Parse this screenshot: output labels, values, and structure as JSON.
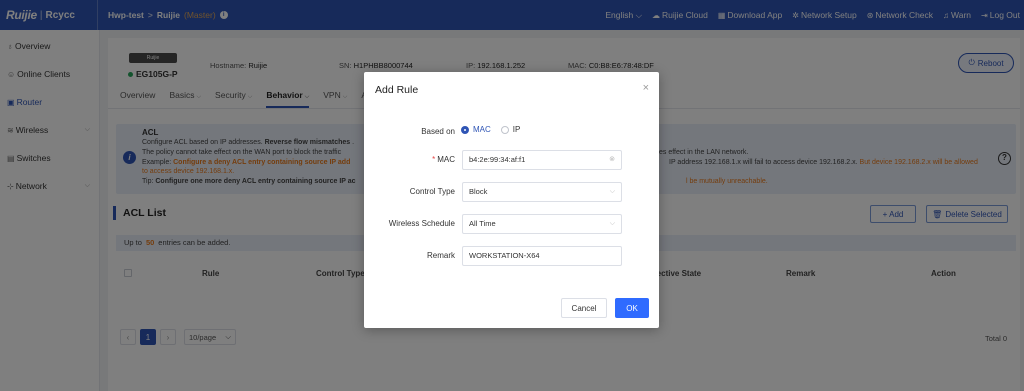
{
  "topbar": {
    "logo_main": "Ruijie",
    "logo_sep": "|",
    "logo_sub": "Rcycc",
    "project": "Hwp-test",
    "crumb_sep": ">",
    "device_name": "Ruijie",
    "device_role": "(Master)",
    "info_icon": "i",
    "right": [
      {
        "icon": "",
        "label": "English ⌵",
        "name": "language-select"
      },
      {
        "icon": "☁",
        "label": "Ruijie Cloud",
        "name": "ruijie-cloud-link"
      },
      {
        "icon": "▦",
        "label": "Download App",
        "name": "download-app-link"
      },
      {
        "icon": "✲",
        "label": "Network Setup",
        "name": "network-setup-link"
      },
      {
        "icon": "⊛",
        "label": "Network Check",
        "name": "network-check-link"
      },
      {
        "icon": "♫",
        "label": "Warn",
        "name": "warn-link"
      },
      {
        "icon": "⇥",
        "label": "Log Out",
        "name": "logout-link"
      }
    ]
  },
  "sidebar": {
    "items": [
      {
        "icon": "♁",
        "label": "Overview",
        "chevron": "",
        "active": false
      },
      {
        "icon": "☺",
        "label": "Online Clients",
        "chevron": "",
        "active": false
      },
      {
        "icon": "▣",
        "label": "Router",
        "chevron": "",
        "active": true
      },
      {
        "icon": "≋",
        "label": "Wireless",
        "chevron": "⌵",
        "active": false
      },
      {
        "icon": "▤",
        "label": "Switches",
        "chevron": "",
        "active": false
      },
      {
        "icon": "⊹",
        "label": "Network",
        "chevron": "⌵",
        "active": false
      }
    ]
  },
  "device": {
    "badge": "Ruijie",
    "model": "EG105G-P",
    "hostname_label": "Hostname:",
    "hostname": "Ruijie",
    "sn_label": "SN:",
    "sn": "H1PHBB8000744",
    "ip_label": "IP:",
    "ip": "192.168.1.252",
    "mac_label": "MAC:",
    "mac": "C0:B8:E6:78:48:DF",
    "reboot_icon": "⏻",
    "reboot_label": "Reboot"
  },
  "tabs": [
    {
      "label": "Overview",
      "caret": "",
      "active": false
    },
    {
      "label": "Basics",
      "caret": "⌵",
      "active": false
    },
    {
      "label": "Security",
      "caret": "⌵",
      "active": false
    },
    {
      "label": "Behavior",
      "caret": "⌵",
      "active": true
    },
    {
      "label": "VPN",
      "caret": "⌵",
      "active": false
    },
    {
      "label": "Adv",
      "caret": "",
      "active": false
    }
  ],
  "notice": {
    "icon": "i",
    "title": "ACL",
    "line1_a": "Configure ACL based on IP addresses. ",
    "line1_b": "Reverse flow mismatches",
    "line1_c": " .",
    "line2": "The policy cannot take effect on the WAN port to block the traffic",
    "line3_a": "Example: ",
    "line3_b": "Configure a deny ACL entry containing source IP add",
    "line4": "to access device 192.168.1.x.",
    "line5_a": "Tip: ",
    "line5_b": "Configure one more deny ACL entry containing source IP ac",
    "right2": "es effect in the LAN network.",
    "right3_a": "IP address 192.168.1.x will fail to access device 192.168.2.x. ",
    "right3_b": "But device 192.168.2.x will be allowed",
    "right5": "l be mutually unreachable.",
    "help_icon": "?"
  },
  "acl": {
    "title": "ACL List",
    "add_label": "+ Add",
    "delete_icon": "🗑",
    "delete_label": "Delete Selected",
    "limit_prefix": "Up to",
    "limit_num": "50",
    "limit_suffix": "entries can be added.",
    "columns": [
      "Rule",
      "Control Type",
      "Effective State",
      "Remark",
      "Action"
    ]
  },
  "pager": {
    "prev": "‹",
    "page": "1",
    "next": "›",
    "size": "10/page",
    "size_caret": "⌵",
    "total": "Total 0"
  },
  "modal": {
    "title": "Add Rule",
    "close": "×",
    "based_on_label": "Based on",
    "based_on_options": [
      {
        "label": "MAC",
        "selected": true
      },
      {
        "label": "IP",
        "selected": false
      }
    ],
    "mac_required": "*",
    "mac_label": "MAC",
    "mac_value": "b4:2e:99:34:af:f1",
    "mac_clear": "⊗",
    "control_type_label": "Control Type",
    "control_type_value": "Block",
    "wireless_schedule_label": "Wireless Schedule",
    "wireless_schedule_value": "All Time",
    "select_caret": "⌵",
    "remark_label": "Remark",
    "remark_value": "WORKSTATION-X64",
    "cancel_label": "Cancel",
    "ok_label": "OK"
  },
  "colors": {
    "primary": "#2f55b5",
    "ok_button": "#2f6bff",
    "accent_orange": "#e87a1b",
    "required": "#e54545"
  }
}
